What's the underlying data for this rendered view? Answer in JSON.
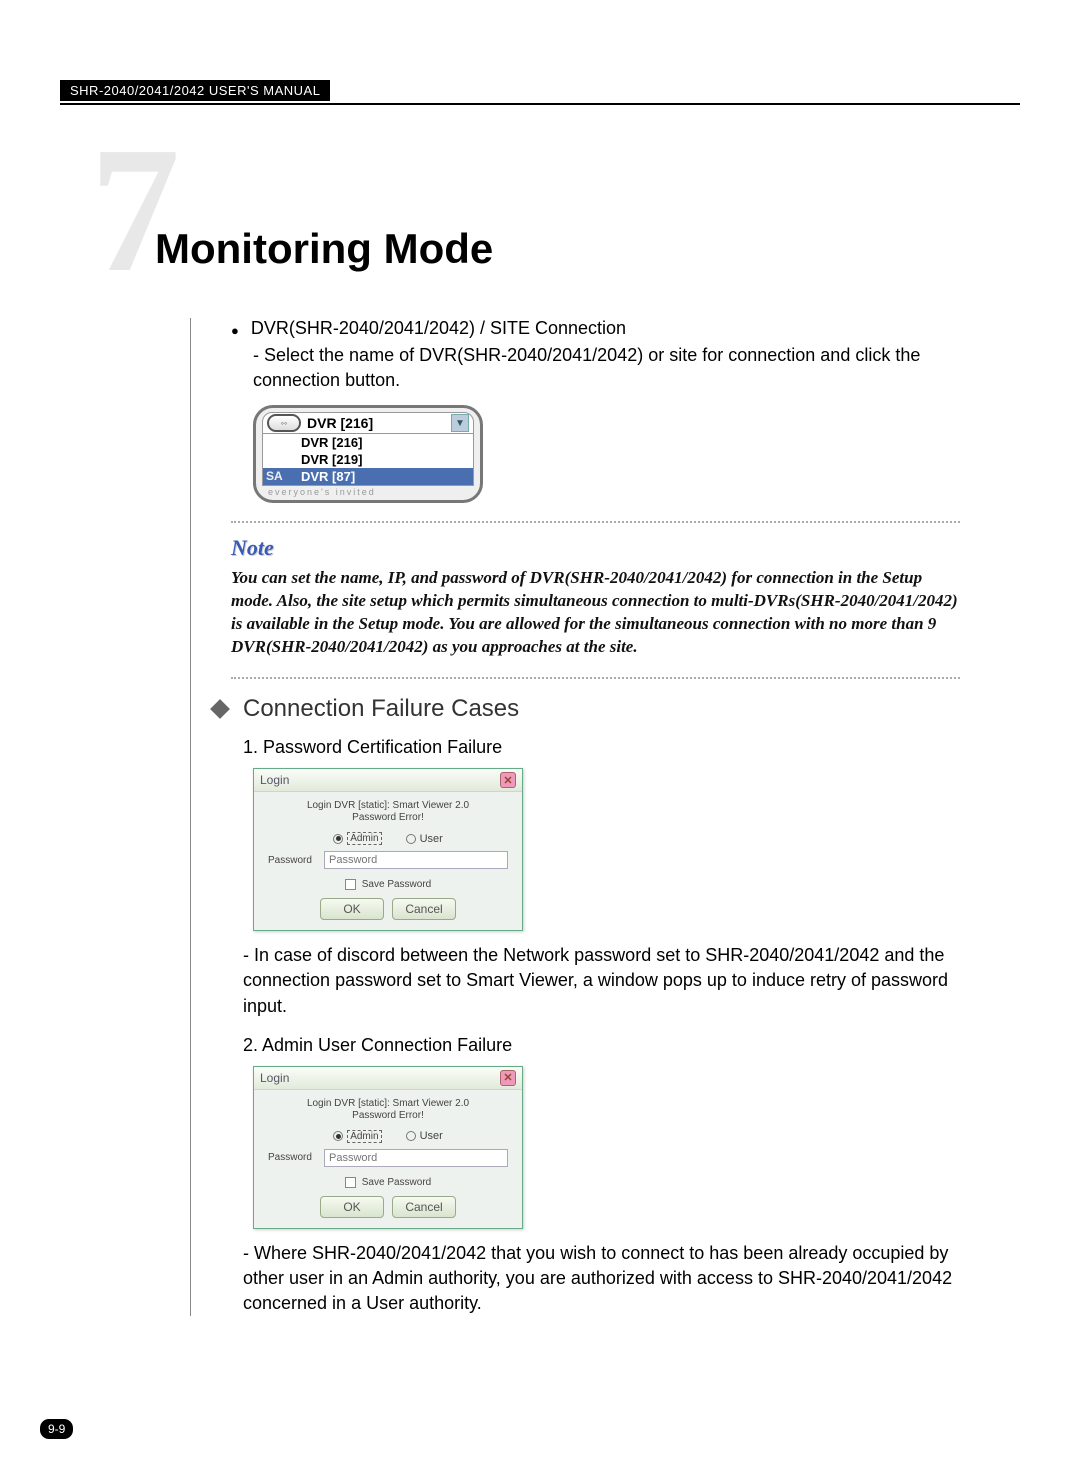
{
  "header": {
    "manual_label": "SHR-2040/2041/2042 USER'S MANUAL"
  },
  "chapter": {
    "number": "7",
    "title": "Monitoring Mode"
  },
  "intro": {
    "bullet": "DVR(SHR-2040/2041/2042) / SITE Connection",
    "sub": "- Select the name of DVR(SHR-2040/2041/2042) or site for connection and click the connection button."
  },
  "dvr_dropdown": {
    "selected": "DVR [216]",
    "items": [
      "DVR [216]",
      "DVR [219]",
      "DVR [87]"
    ],
    "brand_left": "SA",
    "footer": "everyone's invited"
  },
  "note": {
    "heading": "Note",
    "body": "You can set the name, IP, and password of DVR(SHR-2040/2041/2042) for connection in the Setup mode. Also, the site setup which permits simultaneous connection to multi-DVRs(SHR-2040/2041/2042) is available in the Setup mode. You are allowed for the simultaneous connection with no more than 9 DVR(SHR-2040/2041/2042) as you approaches at the site."
  },
  "section": {
    "heading": "Connection Failure Cases"
  },
  "case1": {
    "title": "1. Password Certification Failure",
    "desc": "- In case of discord between the Network password set to SHR-2040/2041/2042 and the connection password set to Smart Viewer, a window pops up to induce retry of password input."
  },
  "case2": {
    "title": "2. Admin User Connection Failure",
    "desc": "- Where SHR-2040/2041/2042 that you wish to connect to has been already occupied by other user in an Admin authority, you are authorized with access to SHR-2040/2041/2042 concerned in a User authority."
  },
  "login_dialog": {
    "title": "Login",
    "message_line1": "Login DVR [static]: Smart Viewer 2.0",
    "message_line2": "Password Error!",
    "opt_admin": "Admin",
    "opt_user": "User",
    "password_label": "Password",
    "save_label": "Save Password",
    "ok": "OK",
    "cancel": "Cancel"
  },
  "page_number": "9-9"
}
